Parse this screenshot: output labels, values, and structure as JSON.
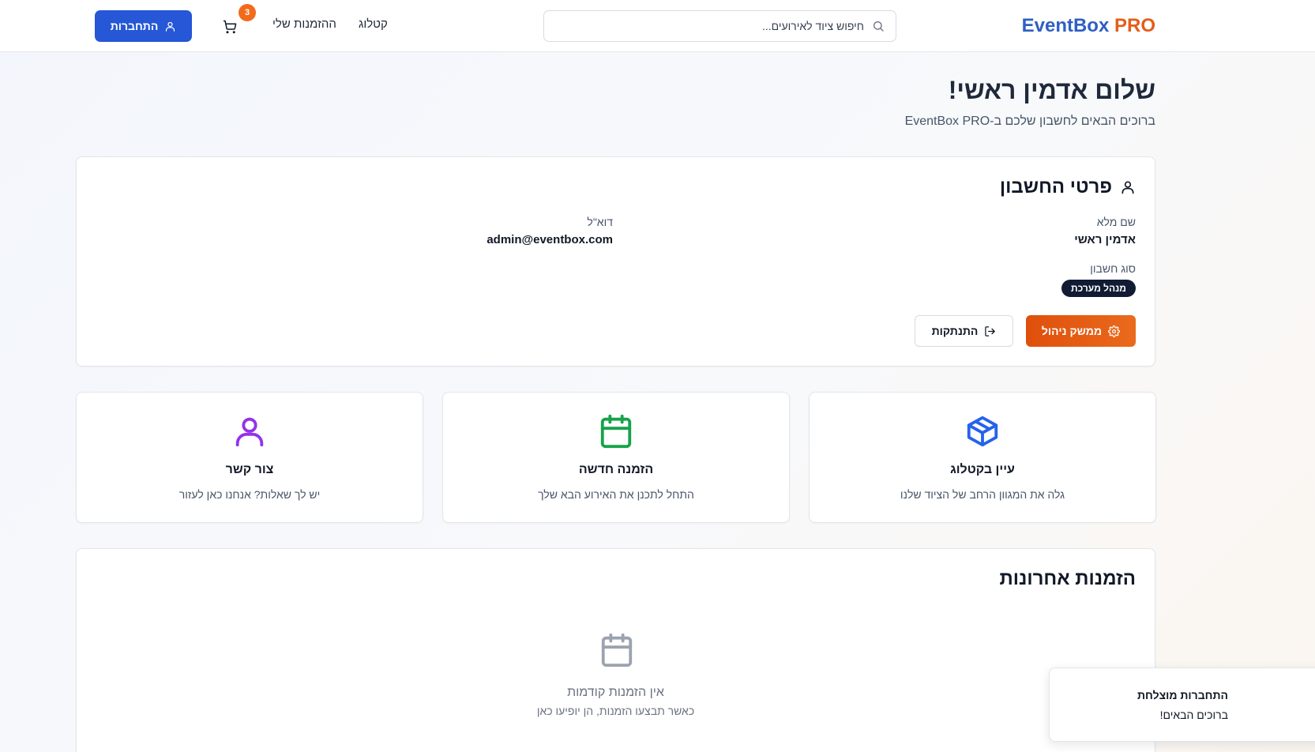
{
  "header": {
    "logo_part1": "EventBox",
    "logo_part2": " PRO",
    "search_placeholder": "חיפוש ציוד לאירועים...",
    "nav": {
      "catalog": "קטלוג",
      "my_orders": "ההזמנות שלי"
    },
    "cart_count": "3",
    "login_label": "התחברות"
  },
  "page": {
    "title": "שלום אדמין ראשי!",
    "subtitle": "ברוכים הבאים לחשבון שלכם ב-EventBox PRO"
  },
  "account": {
    "title": "פרטי החשבון",
    "full_name_label": "שם מלא",
    "full_name_value": "אדמין ראשי",
    "email_label": "דוא\"ל",
    "email_value": "admin@eventbox.com",
    "type_label": "סוג חשבון",
    "type_value": "מנהל מערכת",
    "admin_button": "ממשק ניהול",
    "logout_button": "התנתקות"
  },
  "actions": [
    {
      "title": "עיין בקטלוג",
      "desc": "גלה את המגוון הרחב של הציוד שלנו",
      "icon": "package-icon",
      "color": "#2563eb"
    },
    {
      "title": "הזמנה חדשה",
      "desc": "התחל לתכנן את האירוע הבא שלך",
      "icon": "calendar-icon",
      "color": "#16a34a"
    },
    {
      "title": "צור קשר",
      "desc": "יש לך שאלות? אנחנו כאן לעזור",
      "icon": "user-icon",
      "color": "#9333ea"
    }
  ],
  "recent_orders": {
    "title": "הזמנות אחרונות",
    "empty_title": "אין הזמנות קודמות",
    "empty_subtitle": "כאשר תבצעו הזמנות, הן יופיעו כאן"
  },
  "toast": {
    "title": "התחברות מוצלחת",
    "description": "ברוכים הבאים!"
  }
}
